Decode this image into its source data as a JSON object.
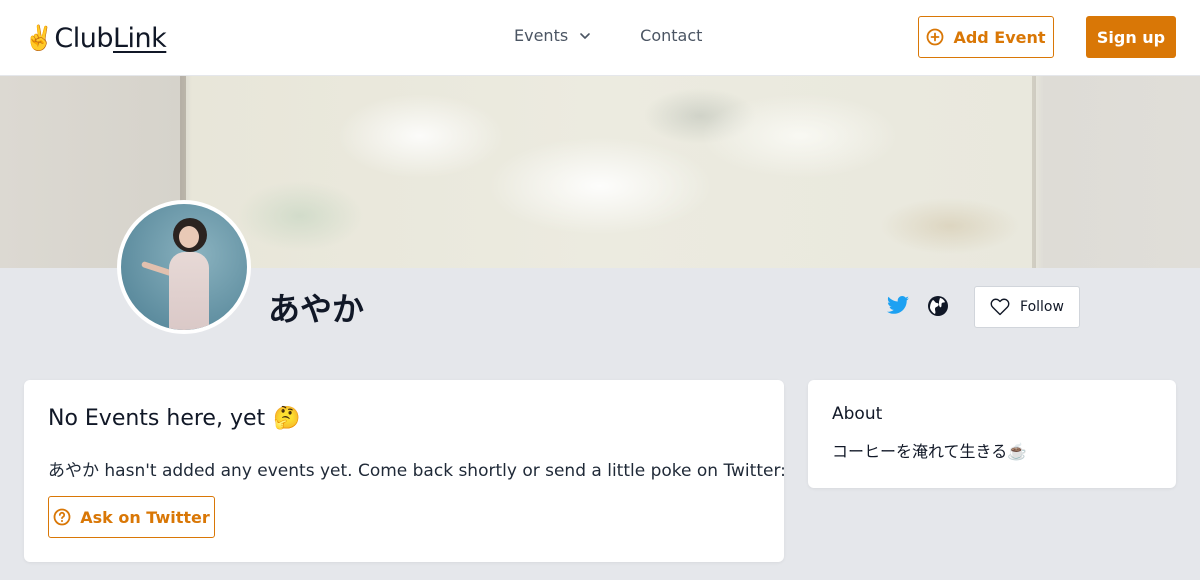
{
  "header": {
    "logo_hand": "✌️",
    "logo_club": "Club",
    "logo_link": "Link",
    "nav": [
      {
        "label": "Events",
        "has_dropdown": true
      },
      {
        "label": "Contact",
        "has_dropdown": false
      }
    ],
    "add_event_label": "Add Event",
    "signup_label": "Sign up"
  },
  "profile": {
    "name": "あやか",
    "follow_label": "Follow",
    "icons": [
      "twitter-icon",
      "globe-icon",
      "heart-icon"
    ]
  },
  "events": {
    "title": "No Events here, yet",
    "title_emoji": "🤔",
    "message": "あやか hasn't added any events yet. Come back shortly or send a little poke on Twitter:",
    "ask_label": "Ask on Twitter"
  },
  "about": {
    "title": "About",
    "text": "コーヒーを淹れて生きる☕️"
  },
  "colors": {
    "accent": "#d97706",
    "twitter": "#1da1f2",
    "background": "#e5e7eb"
  }
}
